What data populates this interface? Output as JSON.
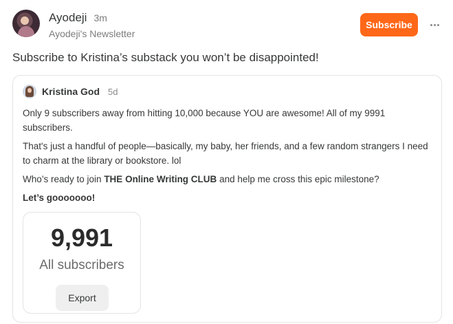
{
  "post": {
    "author": "Ayodeji",
    "time": "3m",
    "newsletter": "Ayodeji's Newsletter",
    "subscribe_label": "Subscribe",
    "body": "Subscribe to Kristina’s substack you won’t be disappointed!"
  },
  "embed": {
    "author": "Kristina God",
    "time": "5d",
    "paragraphs": {
      "p1": "Only 9 subscribers away from hitting 10,000 because YOU are awesome! All of my 9991 subscribers.",
      "p2": "That's just a handful of people—basically, my baby, her friends, and a few random strangers I need to charm at the library or bookstore. lol",
      "p3_before": "Who’s ready to join ",
      "p3_bold": "THE Online Writing CLUB",
      "p3_after": " and help me cross this epic milestone?",
      "p4": "Let’s gooooooo!"
    },
    "stat": {
      "number": "9,991",
      "label": "All subscribers",
      "export_label": "Export"
    }
  },
  "colors": {
    "accent": "#ff6719",
    "text": "#363737",
    "muted": "#7c7c7c",
    "border": "#e3e3e3"
  },
  "icons": {
    "more": "more-horizontal-icon"
  }
}
